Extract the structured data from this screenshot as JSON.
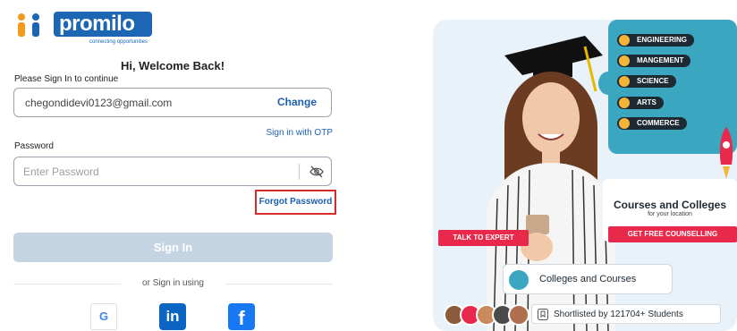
{
  "brand": {
    "logo_text": "promilo",
    "tagline": "connecting opportunities",
    "primary_color": "#1c66b3"
  },
  "login": {
    "welcome": "Hi, Welcome Back!",
    "subtitle": "Please Sign In to continue",
    "email_value": "chegondidevi0123@gmail.com",
    "change_label": "Change",
    "otp_link": "Sign in with OTP",
    "password_label": "Password",
    "password_placeholder": "Enter Password",
    "forgot_label": "Forgot Password",
    "signin_label": "Sign In",
    "or_label": "or Sign in using",
    "social": {
      "google": "G",
      "linkedin": "in",
      "facebook": "f"
    },
    "highlight_color": "#d62b2b"
  },
  "banner": {
    "streams": [
      "ENGINEERING",
      "MANGEMENT",
      "SCIENCE",
      "ARTS",
      "COMMERCE"
    ],
    "card_title": "Courses and Colleges",
    "card_subtitle": "for your location",
    "counsel_label": "GET FREE COUNSELLING",
    "talk_label": "TALK TO EXPERT",
    "colleges_label": "Colleges and Courses",
    "shortlisted_label": "Shortlisted by 121704+ Students",
    "accent_color": "#e8294b",
    "teal_color": "#3aa6bf"
  }
}
